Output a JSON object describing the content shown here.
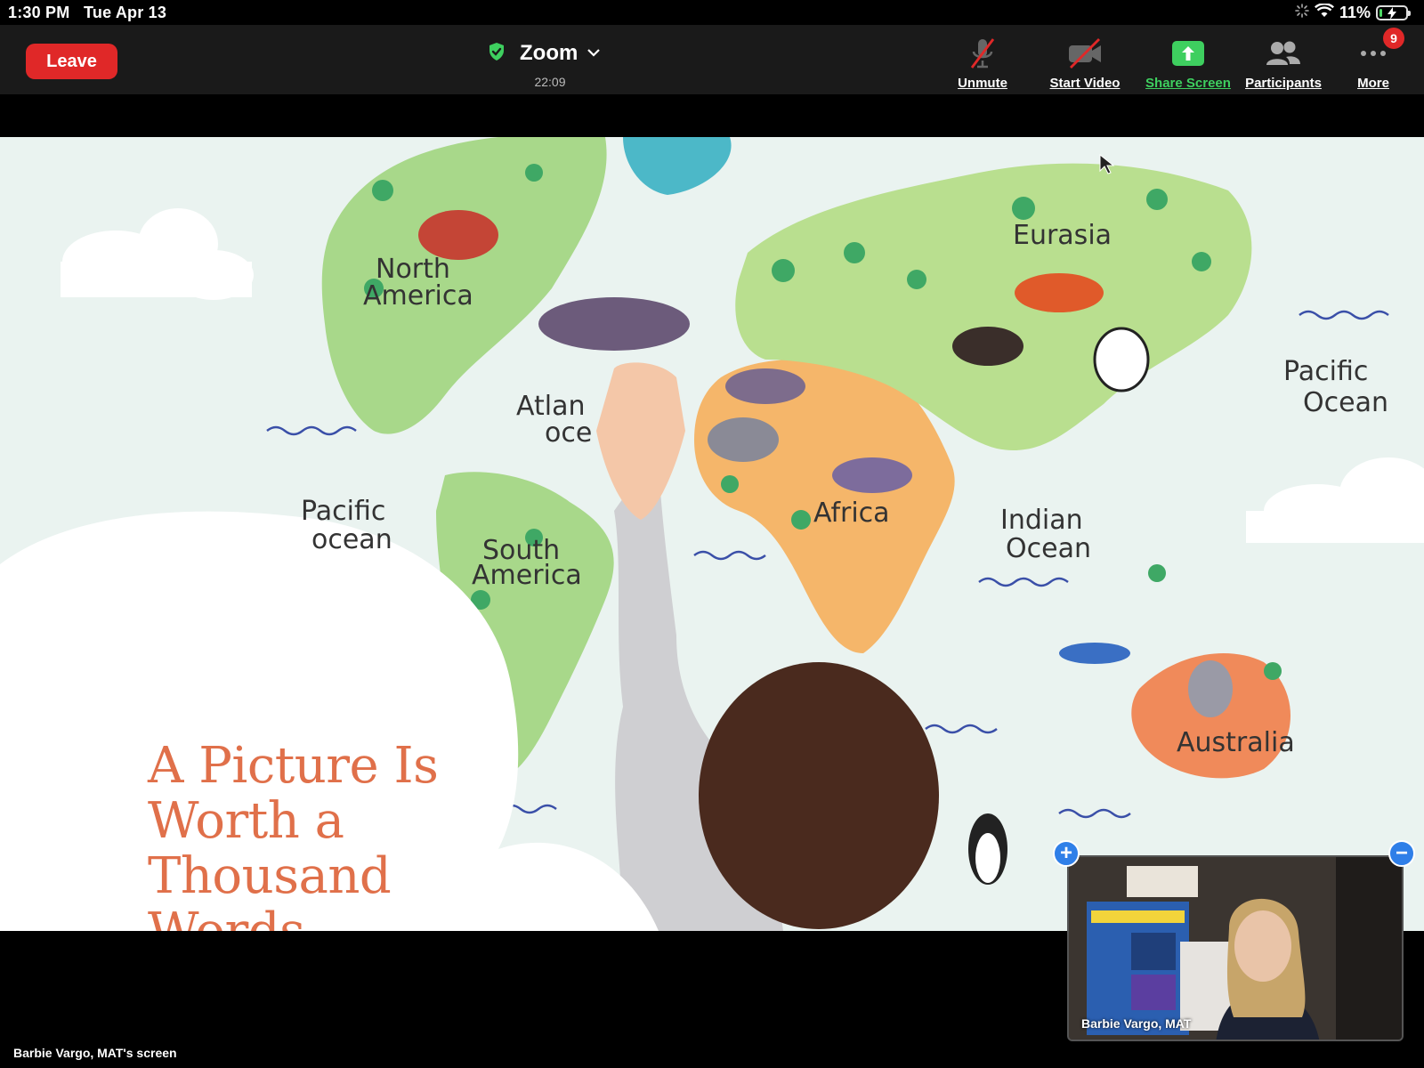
{
  "status_bar": {
    "time": "1:30 PM",
    "date": "Tue Apr 13",
    "battery": "11%",
    "battery_level": 0.11
  },
  "header": {
    "leave_label": "Leave",
    "title": "Zoom",
    "timer": "22:09",
    "controls": {
      "unmute": "Unmute",
      "start_video": "Start Video",
      "share_screen": "Share Screen",
      "participants": "Participants",
      "more": "More",
      "more_badge": "9"
    }
  },
  "slide": {
    "title_lines": [
      "A Picture Is",
      "Worth a",
      "Thousand",
      "Words"
    ],
    "map_labels": {
      "north_america": [
        "North",
        "America"
      ],
      "atlantic": [
        "Atlan",
        "oce"
      ],
      "eurasia": "Eurasia",
      "pacific_right": [
        "Pacific",
        "Ocean"
      ],
      "pacific_left": [
        "Pacific",
        "ocean"
      ],
      "south_america": [
        "South",
        "America"
      ],
      "africa": "Africa",
      "indian": [
        "Indian",
        "Ocean"
      ],
      "australia": "Australia"
    }
  },
  "self_view": {
    "name": "Barbie Vargo, MAT"
  },
  "share_caption": "Barbie Vargo, MAT's screen",
  "colors": {
    "leave": "#e02828",
    "share_green": "#3ecf5f",
    "title_orange": "#e0704a",
    "pip_blue": "#2f7fe8"
  }
}
